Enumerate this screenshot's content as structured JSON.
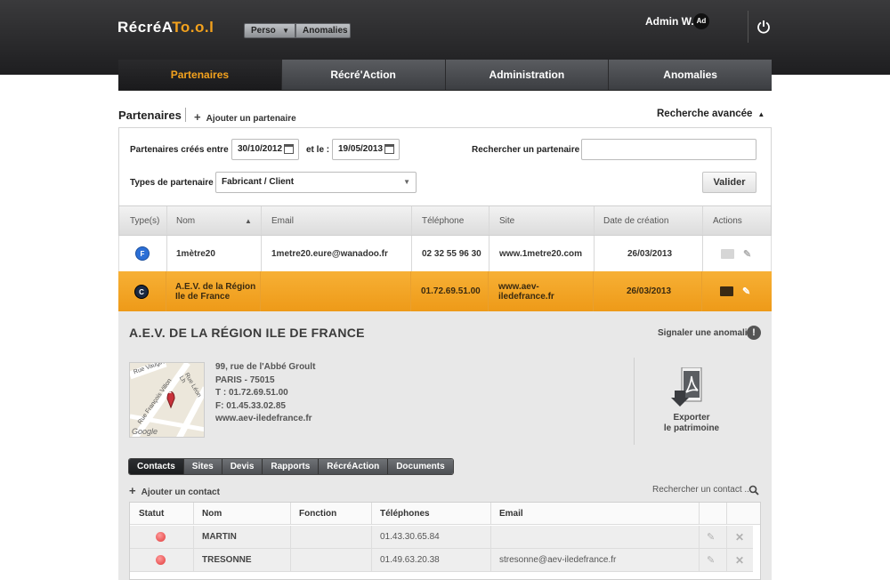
{
  "app": {
    "logo_prefix": "RécréA",
    "logo_suffix": "To.o.l",
    "perso_label": "Perso",
    "anomalies_label": "Anomalies",
    "admin_name": "Admin W.",
    "avatar_initials": "Ad"
  },
  "nav": {
    "tabs": [
      {
        "label": "Partenaires",
        "active": true
      },
      {
        "label": "Récré'Action",
        "active": false
      },
      {
        "label": "Administration",
        "active": false
      },
      {
        "label": "Anomalies",
        "active": false
      }
    ]
  },
  "page": {
    "title": "Partenaires",
    "add_partner_label": "Ajouter un partenaire",
    "advanced_search_label": "Recherche avancée"
  },
  "filter": {
    "created_between_label": "Partenaires créés entre :",
    "date_from": "30/10/2012",
    "and_label": "et le :",
    "date_to": "19/05/2013",
    "search_label": "Rechercher un partenaire :",
    "search_value": "",
    "type_label": "Types de partenaire :",
    "type_value": "Fabricant / Client",
    "submit_label": "Valider"
  },
  "grid": {
    "headers": [
      "Type(s)",
      "Nom",
      "Email",
      "Téléphone",
      "Site",
      "Date de création",
      "Actions"
    ],
    "rows": [
      {
        "type": "F",
        "name_line1": "1mètre20",
        "name_line2": "",
        "email": "1metre20.eure@wanadoo.fr",
        "phone": "02 32 55 96 30",
        "site_line1": "www.1metre20.com",
        "site_line2": "",
        "date": "26/03/2013",
        "selected": false
      },
      {
        "type": "C",
        "name_line1": "A.E.V. de la Région",
        "name_line2": "Ile de France",
        "email": "",
        "phone": "01.72.69.51.00",
        "site_line1": "www.aev-",
        "site_line2": "iledefrance.fr",
        "date": "26/03/2013",
        "selected": true
      }
    ]
  },
  "detail": {
    "title": "A.E.V. DE LA RÉGION ILE DE FRANCE",
    "report_label": "Signaler une anomalie",
    "address": {
      "street": "99, rue de l'Abbé Groult",
      "city": "PARIS - 75015",
      "phone": "T : 01.72.69.51.00",
      "fax": "F: 01.45.33.02.85",
      "site": "www.aev-iledefrance.fr"
    },
    "map": {
      "marker": "1",
      "street1": "Rue Vaugirard",
      "street2": "Rue François Villon",
      "street3": "Rue Léon Lh",
      "watermark": "Google"
    },
    "export_line1": "Exporter",
    "export_line2": "le patrimoine",
    "subtabs": [
      {
        "label": "Contacts",
        "active": true
      },
      {
        "label": "Sites",
        "active": false
      },
      {
        "label": "Devis",
        "active": false
      },
      {
        "label": "Rapports",
        "active": false
      },
      {
        "label": "RécréAction",
        "active": false
      },
      {
        "label": "Documents",
        "active": false
      }
    ],
    "add_contact_label": "Ajouter un contact",
    "search_contact_placeholder": "Rechercher un contact ...",
    "contacts": {
      "headers": [
        "Statut",
        "Nom",
        "Fonction",
        "Téléphones",
        "Email"
      ],
      "rows": [
        {
          "name": "MARTIN",
          "function": "",
          "phone": "01.43.30.65.84",
          "email": ""
        },
        {
          "name": "TRESONNE",
          "function": "",
          "phone": "01.49.63.20.38",
          "email": "stresonne@aev-iledefrance.fr"
        }
      ]
    }
  },
  "colors": {
    "accent": "#f4a21d",
    "selected_row": "#f2a526",
    "status_red": "#e84a4a"
  }
}
